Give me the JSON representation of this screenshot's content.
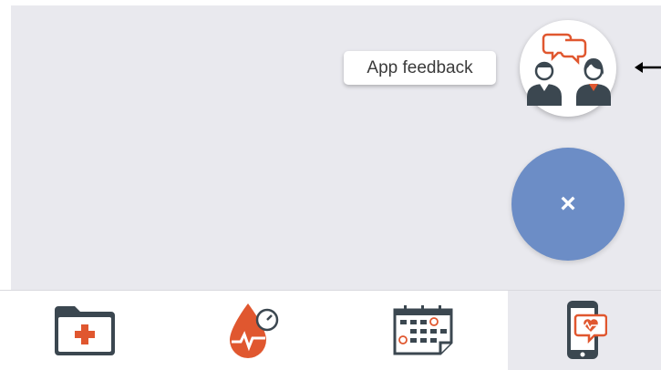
{
  "tooltip": {
    "label": "App feedback"
  },
  "feedback_fab": {
    "icon": "doctors-chat-icon"
  },
  "close_fab": {
    "icon": "close-icon",
    "glyph": "×"
  },
  "tabbar": {
    "tabs": [
      {
        "icon": "medical-folder-icon",
        "active": false
      },
      {
        "icon": "blood-pressure-icon",
        "active": false
      },
      {
        "icon": "calendar-icon",
        "active": false
      },
      {
        "icon": "phone-heart-chat-icon",
        "active": true
      }
    ]
  },
  "colors": {
    "accent_orange": "#e0572f",
    "icon_dark": "#3b4750",
    "fab_blue": "#6c8dc6",
    "background": "#e9e9ee"
  }
}
